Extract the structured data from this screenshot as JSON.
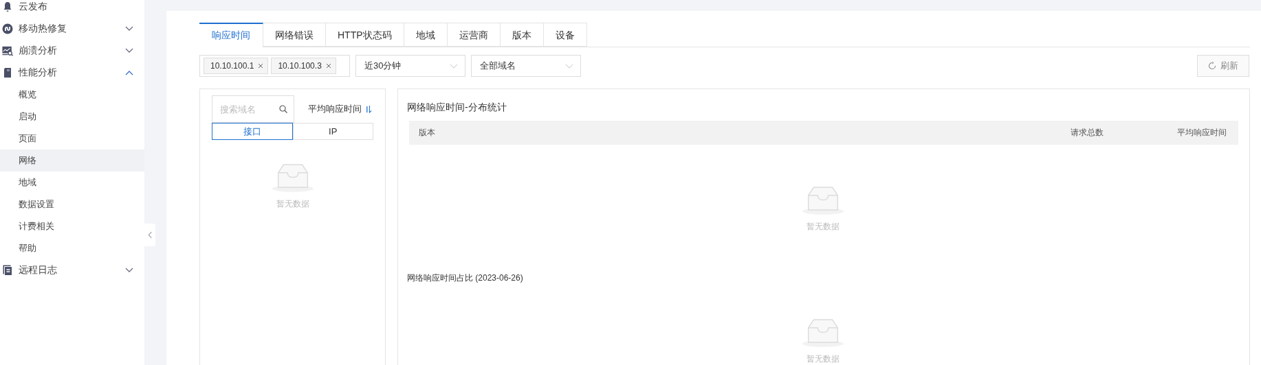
{
  "sidebar": {
    "items": [
      {
        "label": "云发布"
      },
      {
        "label": "移动热修复",
        "expanded": false
      },
      {
        "label": "崩溃分析",
        "expanded": false
      },
      {
        "label": "性能分析",
        "expanded": true,
        "children": [
          {
            "label": "概览",
            "selected": false
          },
          {
            "label": "启动",
            "selected": false
          },
          {
            "label": "页面",
            "selected": false
          },
          {
            "label": "网络",
            "selected": true
          },
          {
            "label": "地域",
            "selected": false
          },
          {
            "label": "数据设置",
            "selected": false
          },
          {
            "label": "计费相关",
            "selected": false
          },
          {
            "label": "帮助",
            "selected": false
          }
        ]
      },
      {
        "label": "远程日志",
        "expanded": false
      }
    ]
  },
  "tabs": [
    {
      "label": "响应时间",
      "selected": true
    },
    {
      "label": "网络错误",
      "selected": false
    },
    {
      "label": "HTTP状态码",
      "selected": false
    },
    {
      "label": "地域",
      "selected": false
    },
    {
      "label": "运营商",
      "selected": false
    },
    {
      "label": "版本",
      "selected": false
    },
    {
      "label": "设备",
      "selected": false
    }
  ],
  "filters": {
    "tags": [
      "10.10.100.1",
      "10.10.100.3"
    ],
    "time_select": "近30分钟",
    "domain_select": "全部域名",
    "refresh_button": "刷新"
  },
  "left_panel": {
    "search": {
      "placeholder": "搜索域名"
    },
    "sort_label": "平均响应时间",
    "segments": [
      {
        "label": "接口",
        "selected": true
      },
      {
        "label": "IP",
        "selected": false
      }
    ],
    "empty_text": "暂无数据"
  },
  "right_panel": {
    "title": "网络响应时间-分布统计",
    "columns": [
      "版本",
      "请求总数",
      "平均响应时间"
    ],
    "empty_text": "暂无数据",
    "section_title": "网络响应时间占比 (2023-06-26)",
    "section_empty_text": "暂无数据"
  }
}
